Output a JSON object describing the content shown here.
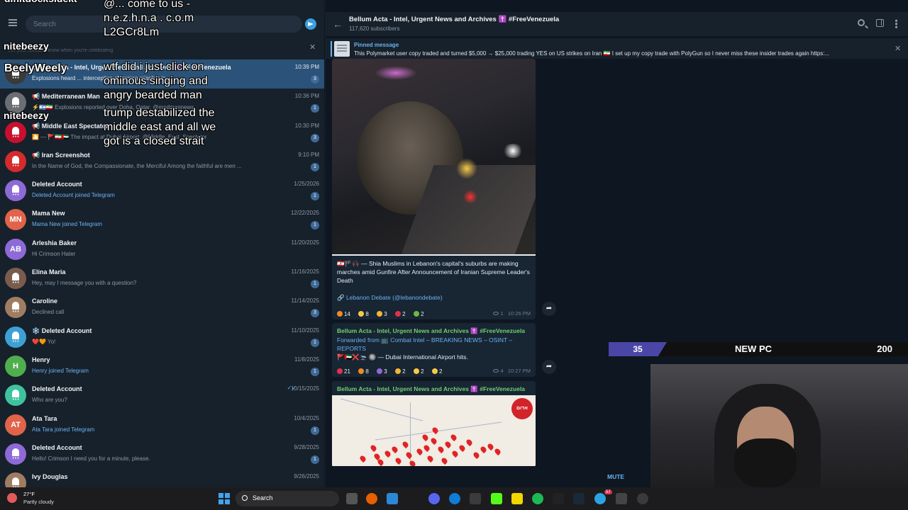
{
  "sidebar": {
    "search_placeholder": "Search",
    "notice": "Let your contacts know when you're celebrating",
    "chats": [
      {
        "name": "Bellum Acta - Intel, Urgent News and Archives ✝️ #FreeVenezuela",
        "time": "10:39 PM",
        "preview": "Explosions heard ... interception of Iranian missiles in ...",
        "badge": "3",
        "avatar_color": "#3a3a3a",
        "avatar_text": ""
      },
      {
        "name": "📢 Mediterranean Man",
        "time": "10:36 PM",
        "preview": "⚡️🇮🇱🇮🇷 Explosions reported over Doha, Qatar. @medmannews",
        "badge": "1",
        "avatar_color": "#6b6e72",
        "avatar_text": ""
      },
      {
        "name": "📢 Middle East Spectator",
        "time": "10:30 PM",
        "preview": "🎦 — 🚩🇮🇷🇦🇪 The impact at Dubai Airport. @Middle_East_Spectator",
        "badge": "3",
        "avatar_color": "#c8102e",
        "avatar_text": ""
      },
      {
        "name": "📢 Iran Screenshot",
        "time": "9:10 PM",
        "preview": "In the Name of God, the Compassionate, the Merciful Among the faithful are men ...",
        "badge": "1",
        "avatar_color": "#d42b2b",
        "avatar_text": ""
      },
      {
        "name": "Deleted Account",
        "time": "1/25/2026",
        "preview": "Deleted Account joined Telegram",
        "badge": "1",
        "avatar_color": "#8e6ad6",
        "avatar_text": "",
        "link": true
      },
      {
        "name": "Mama New",
        "time": "12/22/2025",
        "preview": "Mama New joined Telegram",
        "badge": "1",
        "avatar_color": "#e0634a",
        "avatar_text": "MN",
        "link": true
      },
      {
        "name": "Arleshia Baker",
        "time": "11/20/2025",
        "preview": "Hi Crimson Hater",
        "badge": "",
        "avatar_color": "#8e6ad6",
        "avatar_text": "AB"
      },
      {
        "name": "Elina Maria",
        "time": "11/16/2025",
        "preview": "Hey, may I message you with a question?",
        "badge": "1",
        "avatar_color": "#7a5c4e",
        "avatar_text": ""
      },
      {
        "name": "Caroline",
        "time": "11/14/2025",
        "preview": "Declined call",
        "badge": "3",
        "avatar_color": "#a07d62",
        "avatar_text": ""
      },
      {
        "name": "❄️ Deleted Account",
        "time": "11/10/2025",
        "preview": "❤️🧡 Yo!",
        "badge": "1",
        "avatar_color": "#3ea1d6",
        "avatar_text": ""
      },
      {
        "name": "Henry",
        "time": "11/8/2025",
        "preview": "Henry joined Telegram",
        "badge": "1",
        "avatar_color": "#4fae4e",
        "avatar_text": "H",
        "link": true
      },
      {
        "name": "Deleted Account",
        "time": "10/15/2025",
        "preview": "Who are you?",
        "badge": "",
        "avatar_color": "#3ec3a0",
        "avatar_text": "",
        "ticks": "✓✓"
      },
      {
        "name": "Ata Tara",
        "time": "10/4/2025",
        "preview": "Ata Tara joined Telegram",
        "badge": "1",
        "avatar_color": "#e0634a",
        "avatar_text": "AT",
        "link": true
      },
      {
        "name": "Deleted Account",
        "time": "9/28/2025",
        "preview": "Hello! Crimson I need you for a minute, please.",
        "badge": "1",
        "avatar_color": "#8e6ad6",
        "avatar_text": ""
      },
      {
        "name": "Ivy Douglas",
        "time": "9/26/2025",
        "preview": "",
        "badge": "",
        "avatar_color": "#a07d62",
        "avatar_text": ""
      }
    ]
  },
  "overlay": {
    "top_user": "dinitdocksidekt",
    "top_msg": "@... come to us - n.e.z.h.n.a . c.o.m L2GCr8Lm",
    "user1": "nitebeezy",
    "user2": "BeelyWeely",
    "msg2": "wtf did i just click on ominous singing and angry bearded man",
    "user3": "nitebeezy",
    "msg3": "trump destabilized the middle east and all we got is a closed strait"
  },
  "header": {
    "title": "Bellum Acta - Intel, Urgent News and Archives ✝️ #FreeVenezuela",
    "subscribers": "117,620 subscribers"
  },
  "pinned": {
    "label": "Pinned message",
    "text": "This Polymarket user copy traded and turned $5,000 → $25,000 trading YES on US strikes on Iran 🇮🇷 I set up my copy trade with PolyGun so I never miss these insider trades again https:..."
  },
  "messages": {
    "m1": {
      "text": "🇱🇧🏴🙌🏿 — Shia Muslims in Lebanon's capital's suburbs are making marches amid Gunfire After Announcement of Iranian Supreme Leader's Death",
      "link": "🔗 Lebanon Debate (@lebanondebate)",
      "reactions": [
        "14",
        "8",
        "3",
        "2",
        "2"
      ],
      "views": "1",
      "time": "10:26 PM",
      "video_progress": 1.0
    },
    "m2": {
      "sender": "Bellum Acta - Intel, Urgent News and Archives ✝️ #FreeVenezuela",
      "forwarded": "Forwarded from 📺 Combat Intel – BREAKING NEWS – OSINT – REPORTS",
      "text": "🚩🇦🇪❌🛬 🔘 — Dubai International Airport hits.",
      "reactions": [
        "21",
        "8",
        "3",
        "2",
        "2",
        "2"
      ],
      "views": "4",
      "time": "10:27 PM"
    },
    "m3": {
      "sender": "Bellum Acta - Intel, Urgent News and Archives ✝️ #FreeVenezuela",
      "map_logo": "אדום"
    },
    "mute_label": "MUTE"
  },
  "scorebar": {
    "left": "35",
    "middle": "NEW PC",
    "right": "200"
  },
  "taskbar": {
    "temp": "27°F",
    "weather": "Partly cloudy",
    "search_label": "Search",
    "badge": "57"
  }
}
